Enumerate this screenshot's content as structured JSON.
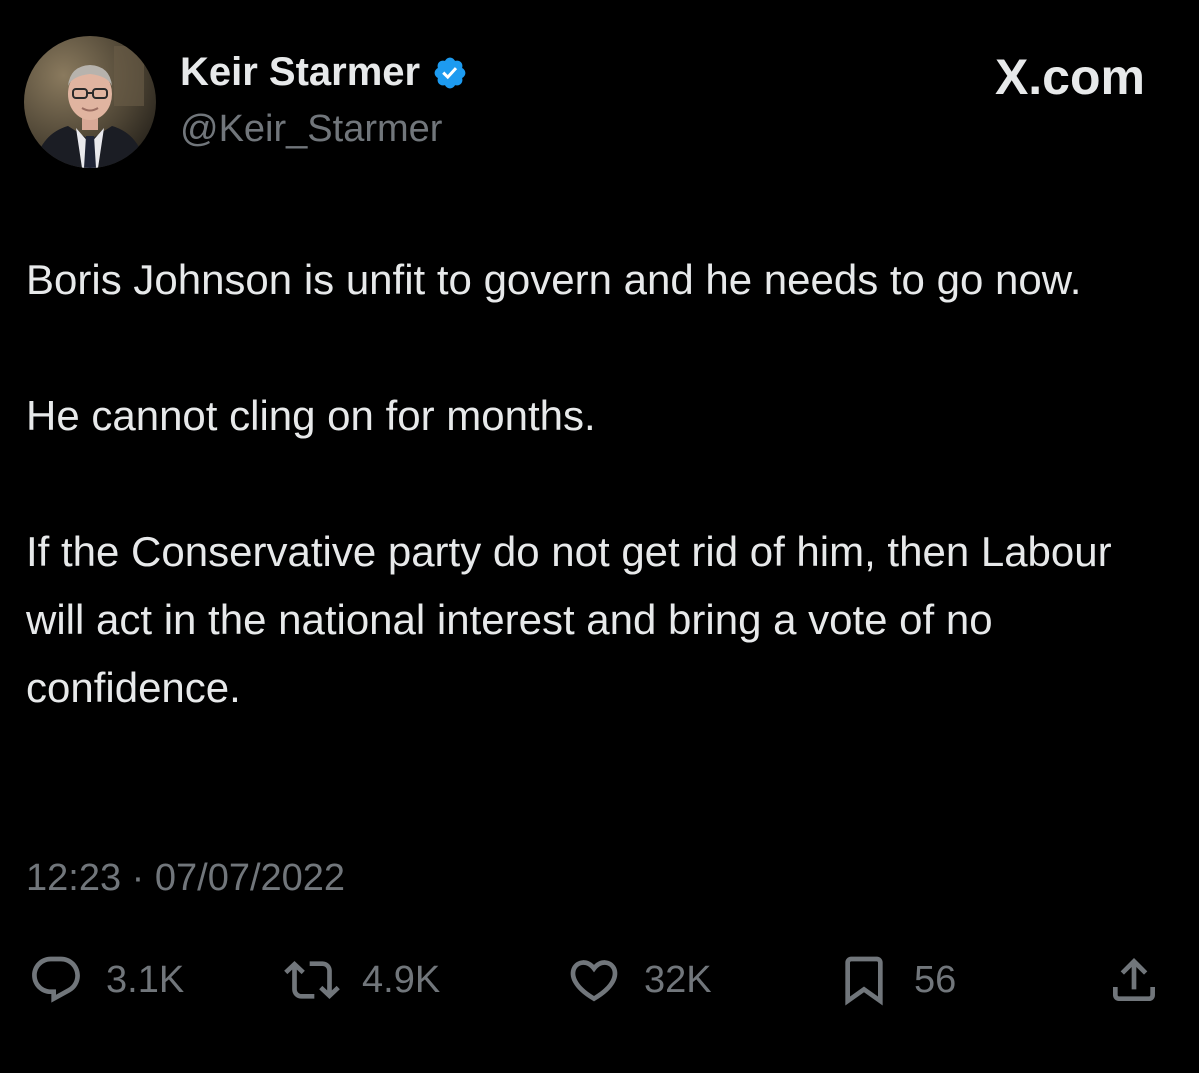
{
  "author": {
    "display_name": "Keir Starmer",
    "handle": "@Keir_Starmer",
    "verified": true,
    "verified_color": "#1d9bf0"
  },
  "brand": "X.com",
  "tweet": {
    "paragraphs": [
      "Boris Johnson is unfit to govern and he needs to go now.",
      "He cannot cling on for months.",
      "If the Conservative party do not get rid of him, then Labour will act in the national interest and bring a vote of no confidence."
    ],
    "timestamp": "12:23 · 07/07/2022"
  },
  "actions": {
    "reply": {
      "icon": "reply-icon",
      "count": "3.1K"
    },
    "repost": {
      "icon": "repost-icon",
      "count": "4.9K"
    },
    "like": {
      "icon": "heart-icon",
      "count": "32K"
    },
    "bookmark": {
      "icon": "bookmark-icon",
      "count": "56"
    },
    "share": {
      "icon": "share-icon"
    }
  },
  "colors": {
    "background": "#000000",
    "text": "#e7e9ea",
    "secondary_text": "#71767b"
  }
}
